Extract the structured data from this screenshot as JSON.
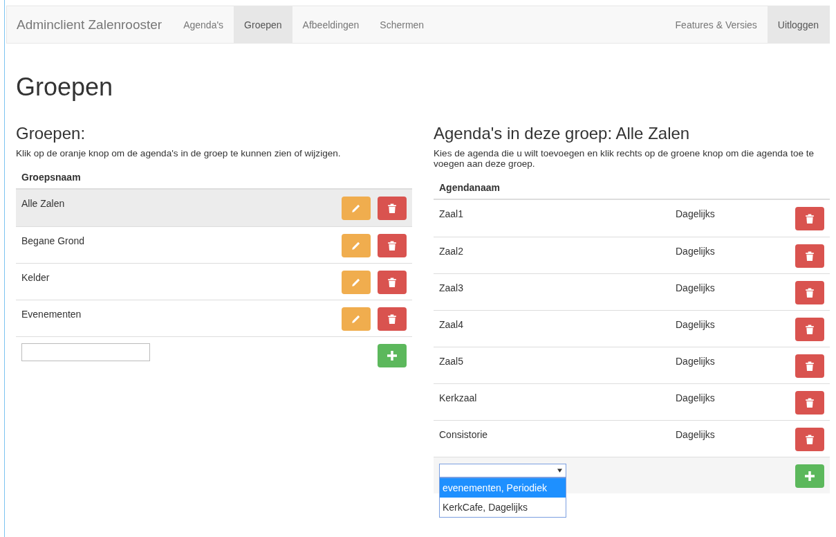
{
  "nav": {
    "brand": "Adminclient Zalenrooster",
    "items": [
      {
        "label": "Agenda's",
        "selected": false
      },
      {
        "label": "Groepen",
        "selected": true
      },
      {
        "label": "Afbeeldingen",
        "selected": false
      },
      {
        "label": "Schermen",
        "selected": false
      }
    ],
    "right_items": [
      {
        "label": "Features & Versies",
        "selected": false
      },
      {
        "label": "Uitloggen",
        "selected": true
      }
    ]
  },
  "page_title": "Groepen",
  "groups": {
    "heading": "Groepen:",
    "instructions": "Klik op de oranje knop om de agenda's in de groep te kunnen zien of wijzigen.",
    "column": "Groepsnaam",
    "rows": [
      {
        "name": "Alle Zalen",
        "selected": true
      },
      {
        "name": "Begane Grond",
        "selected": false
      },
      {
        "name": "Kelder",
        "selected": false
      },
      {
        "name": "Evenementen",
        "selected": false
      }
    ]
  },
  "agendas": {
    "heading": "Agenda's in deze groep: Alle Zalen",
    "instructions": "Kies de agenda die u wilt toevoegen en klik rechts op de groene knop om die agenda toe te voegen aan deze groep.",
    "column": "Agendanaam",
    "rows": [
      {
        "name": "Zaal1",
        "frequency": "Dagelijks"
      },
      {
        "name": "Zaal2",
        "frequency": "Dagelijks"
      },
      {
        "name": "Zaal3",
        "frequency": "Dagelijks"
      },
      {
        "name": "Zaal4",
        "frequency": "Dagelijks"
      },
      {
        "name": "Zaal5",
        "frequency": "Dagelijks"
      },
      {
        "name": "Kerkzaal",
        "frequency": "Dagelijks"
      },
      {
        "name": "Consistorie",
        "frequency": "Dagelijks"
      }
    ],
    "add_select": {
      "expanded": true,
      "options": [
        {
          "label": "evenementen, Periodiek",
          "selected": true
        },
        {
          "label": "KerkCafe, Dagelijks",
          "selected": false
        }
      ]
    }
  }
}
